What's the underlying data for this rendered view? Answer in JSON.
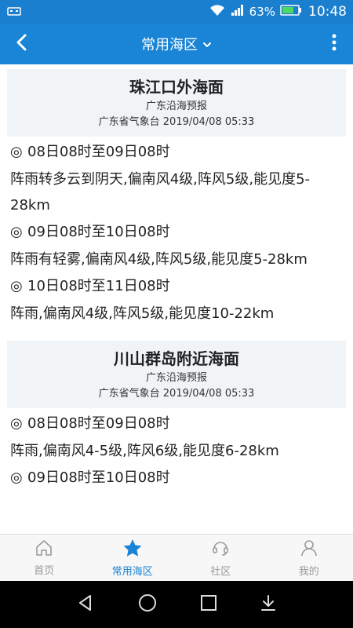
{
  "status": {
    "battery_pct": "63%",
    "time": "10:48"
  },
  "app_bar": {
    "title": "常用海区"
  },
  "areas": [
    {
      "name": "珠江口外海面",
      "source": "广东沿海预报",
      "issuer": "广东省气象台 2019/04/08 05:33",
      "forecasts": [
        {
          "period": "08日08时至09日08时",
          "desc": "阵雨转多云到阴天,偏南风4级,阵风5级,能见度5-28km"
        },
        {
          "period": "09日08时至10日08时",
          "desc": "阵雨有轻雾,偏南风4级,阵风5级,能见度5-28km"
        },
        {
          "period": "10日08时至11日08时",
          "desc": "阵雨,偏南风4级,阵风5级,能见度10-22km"
        }
      ]
    },
    {
      "name": "川山群岛附近海面",
      "source": "广东沿海预报",
      "issuer": "广东省气象台 2019/04/08 05:33",
      "forecasts": [
        {
          "period": "08日08时至09日08时",
          "desc": "阵雨,偏南风4-5级,阵风6级,能见度6-28km"
        },
        {
          "period": "09日08时至10日08时",
          "desc": ""
        }
      ]
    }
  ],
  "nav": {
    "home": "首页",
    "favorite": "常用海区",
    "community": "社区",
    "mine": "我的"
  },
  "colors": {
    "primary": "#1a84d6",
    "status_bar": "#1a7fcf",
    "card_header": "#f0f4f7",
    "nav_inactive": "#999999"
  }
}
